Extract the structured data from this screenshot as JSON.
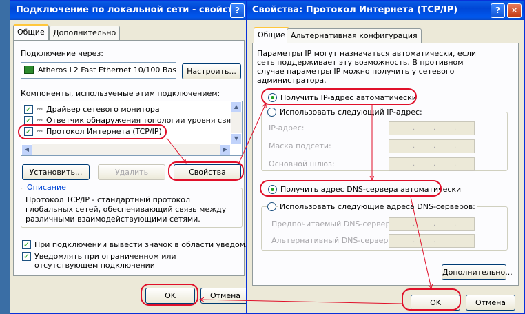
{
  "left_dialog": {
    "title": "Подключение по локальной сети - свойства",
    "tabs": [
      "Общие",
      "Дополнительно"
    ],
    "connect_using_label": "Подключение через:",
    "adapter_name": "Atheros L2 Fast Ethernet 10/100 Bas",
    "configure_button": "Настроить...",
    "components_label": "Компоненты, используемые этим подключением:",
    "components": [
      {
        "label": "Драйвер сетевого монитора",
        "checked": true
      },
      {
        "label": "Ответчик обнаружения топологии уровня связи",
        "checked": true
      },
      {
        "label": "Протокол Интернета (TCP/IP)",
        "checked": true
      }
    ],
    "install_button": "Установить...",
    "remove_button": "Удалить",
    "properties_button": "Свойства",
    "description_title": "Описание",
    "description_text": "Протокол TCP/IP - стандартный протокол глобальных сетей, обеспечивающий связь между различными взаимодействующими сетями.",
    "show_icon_label": "При подключении вывести значок в области уведомлений",
    "notify_label": "Уведомлять при ограниченном или отсутствующем подключении",
    "ok_button": "OK",
    "cancel_button": "Отмена"
  },
  "right_dialog": {
    "title": "Свойства: Протокол Интернета (TCP/IP)",
    "tabs": [
      "Общие",
      "Альтернативная конфигурация"
    ],
    "intro_text": "Параметры IP могут назначаться автоматически, если сеть поддерживает эту возможность. В противном случае параметры IP можно получить у сетевого администратора.",
    "auto_ip_label": "Получить IP-адрес автоматически",
    "manual_ip_label": "Использовать следующий IP-адрес:",
    "ip_address_label": "IP-адрес:",
    "subnet_label": "Маска подсети:",
    "gateway_label": "Основной шлюз:",
    "auto_dns_label": "Получить адрес DNS-сервера автоматически",
    "manual_dns_label": "Использовать следующие адреса DNS-серверов:",
    "preferred_dns_label": "Предпочитаемый DNS-сервер:",
    "alternate_dns_label": "Альтернативный DNS-сервер:",
    "advanced_button": "Дополнительно...",
    "ok_button": "OK",
    "cancel_button": "Отмена"
  },
  "colors": {
    "annotation_red": "#e0102a",
    "titlebar_blue": "#0058ee",
    "dialog_bg": "#ece9d8"
  }
}
